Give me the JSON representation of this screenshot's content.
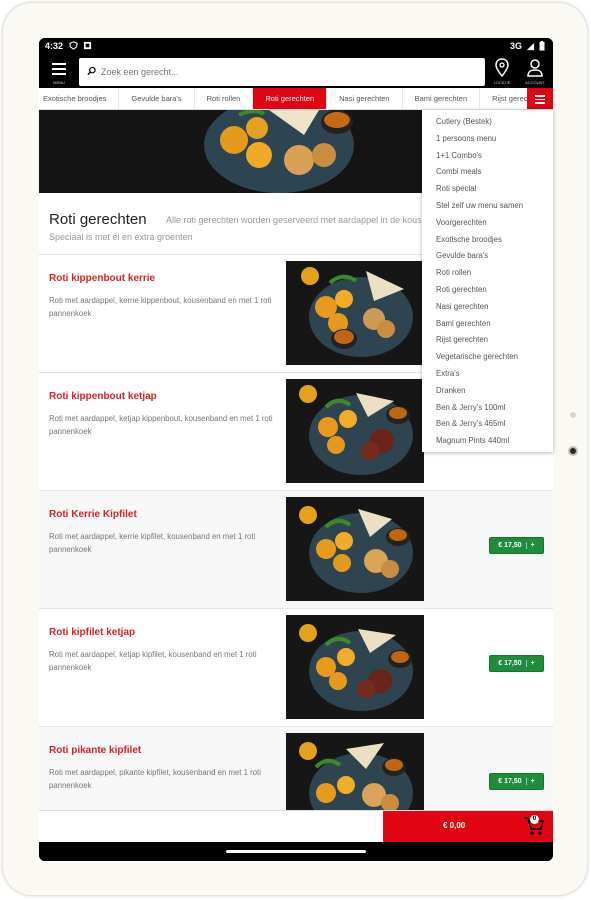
{
  "status": {
    "time": "4:32",
    "network": "3G"
  },
  "topbar": {
    "menu_label": "MENU",
    "search_placeholder": "Zoek een gerecht...",
    "location_label": "LOCATIE",
    "account_label": "ACCOUNT"
  },
  "category_tabs": [
    {
      "label": "Exotische broodjes",
      "active": false
    },
    {
      "label": "Gevulde bara's",
      "active": false
    },
    {
      "label": "Roti rollen",
      "active": false
    },
    {
      "label": "Roti gerechten",
      "active": true
    },
    {
      "label": "Nasi gerechten",
      "active": false
    },
    {
      "label": "Bami gerechten",
      "active": false
    },
    {
      "label": "Rijst gerechten",
      "active": false
    }
  ],
  "section": {
    "title": "Roti gerechten",
    "description": "Alle roti gerechten worden geserveerd met aardappel in de kouseband. Speciaal is met ei en extra groenten"
  },
  "items": [
    {
      "name": "Roti kippenbout kerrie",
      "description": "Roti met aardappel, kerrie kippenbout, kousenband en met 1 roti pannenkoek",
      "price": "",
      "plus": "+"
    },
    {
      "name": "Roti kippenbout ketjap",
      "description": "Roti met aardappel, ketjap kippenbout, kousenband en met 1 roti pannenkoek",
      "price": "",
      "plus": "+"
    },
    {
      "name": "Roti Kerrie Kipfilet",
      "description": "Roti met aardappel, kerrie kipfilet, kousenband en met 1 roti pannenkoek",
      "price": "€ 17,50",
      "plus": "+"
    },
    {
      "name": "Roti kipfilet ketjap",
      "description": "Roti met aardappel, ketjap kipfilet, kousenband en met 1 roti pannenkoek",
      "price": "€ 17,50",
      "plus": "+"
    },
    {
      "name": "Roti pikante kipfilet",
      "description": "Roti met aardappel, pikante kipfilet, kousenband en met 1 roti pannenkoek",
      "price": "€ 17,50",
      "plus": "+"
    }
  ],
  "dropdown": [
    "Cutlery (Bestek)",
    "1 persoons menu",
    "1+1 Combo's",
    "Combi meals",
    "Roti special",
    "Stel zelf uw menu samen",
    "Voorgerechten",
    "Exotische broodjes",
    "Gevulde bara's",
    "Roti rollen",
    "Roti gerechten",
    "Nasi gerechten",
    "Bami gerechten",
    "Rijst gerechten",
    "Vegetarische gerechten",
    "Extra's",
    "Dranken",
    "Ben & Jerry's 100ml",
    "Ben & Jerry's 465ml",
    "Magnum Pints 440ml"
  ],
  "cart": {
    "total": "€ 0,00",
    "count": "0"
  },
  "colors": {
    "accent": "#e10514",
    "price_button": "#1f8c3b",
    "item_name": "#d2232a"
  }
}
